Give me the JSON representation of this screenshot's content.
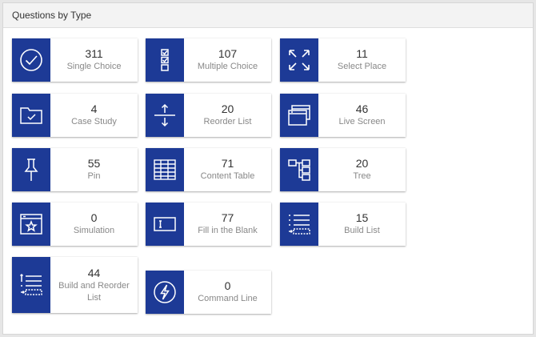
{
  "panel": {
    "title": "Questions by Type"
  },
  "colors": {
    "icon_bg": "#1d3a96",
    "count": "#333333",
    "label": "#888888"
  },
  "cards": [
    {
      "count": "311",
      "label": "Single Choice",
      "icon": "check-circle-icon"
    },
    {
      "count": "107",
      "label": "Multiple Choice",
      "icon": "checkbox-list-icon"
    },
    {
      "count": "11",
      "label": "Select Place",
      "icon": "expand-arrows-icon"
    },
    {
      "count": "4",
      "label": "Case Study",
      "icon": "folder-check-icon"
    },
    {
      "count": "20",
      "label": "Reorder List",
      "icon": "reorder-arrows-icon"
    },
    {
      "count": "46",
      "label": "Live Screen",
      "icon": "windows-icon"
    },
    {
      "count": "55",
      "label": "Pin",
      "icon": "pushpin-icon"
    },
    {
      "count": "71",
      "label": "Content Table",
      "icon": "table-icon"
    },
    {
      "count": "20",
      "label": "Tree",
      "icon": "tree-icon"
    },
    {
      "count": "0",
      "label": "Simulation",
      "icon": "window-star-icon"
    },
    {
      "count": "77",
      "label": "Fill in the Blank",
      "icon": "text-box-icon"
    },
    {
      "count": "15",
      "label": "Build List",
      "icon": "build-list-icon"
    },
    {
      "count": "44",
      "label": "Build and Reorder List",
      "icon": "build-reorder-list-icon"
    },
    {
      "count": "0",
      "label": "Command Line",
      "icon": "lightning-circle-icon"
    }
  ]
}
